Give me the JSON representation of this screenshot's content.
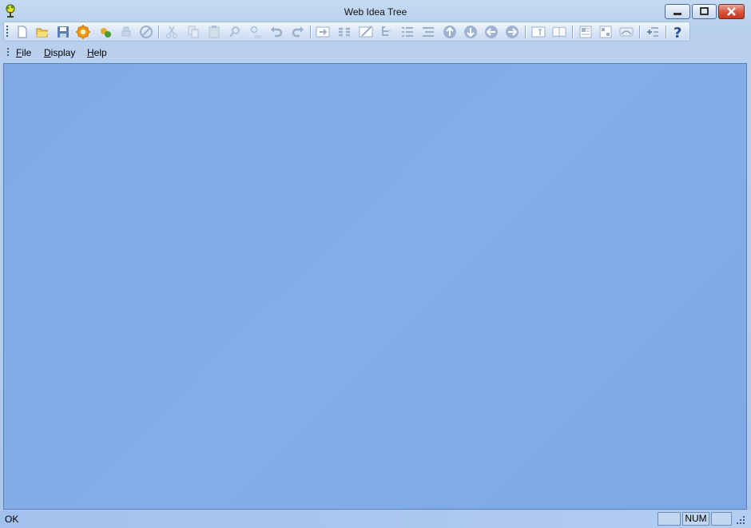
{
  "window": {
    "title": "Web Idea Tree",
    "icon": "tree-icon",
    "controls": [
      "minimize-icon",
      "maximize-icon",
      "close-icon"
    ]
  },
  "toolbar": {
    "buttons": [
      {
        "name": "new-file",
        "icon": "new-file-icon",
        "enabled": true
      },
      {
        "name": "open-folder",
        "icon": "open-folder-icon",
        "enabled": true
      },
      {
        "name": "save",
        "icon": "save-icon",
        "enabled": true
      },
      {
        "name": "publish",
        "icon": "publish-gear-icon",
        "enabled": true
      },
      {
        "name": "web-export",
        "icon": "web-export-icon",
        "enabled": true
      },
      {
        "name": "print",
        "icon": "print-icon",
        "enabled": false
      },
      {
        "name": "cancel",
        "icon": "cancel-icon",
        "enabled": false
      },
      {
        "name": "cut",
        "icon": "cut-icon",
        "enabled": false
      },
      {
        "name": "copy",
        "icon": "copy-icon",
        "enabled": false
      },
      {
        "name": "paste",
        "icon": "paste-icon",
        "enabled": false
      },
      {
        "name": "find",
        "icon": "find-icon",
        "enabled": false
      },
      {
        "name": "replace",
        "icon": "replace-icon",
        "enabled": false
      },
      {
        "name": "undo",
        "icon": "undo-icon",
        "enabled": false
      },
      {
        "name": "redo",
        "icon": "redo-icon",
        "enabled": false
      },
      {
        "name": "insert-node",
        "icon": "insert-node-icon",
        "enabled": false
      },
      {
        "name": "insert-sibling",
        "icon": "insert-sibling-icon",
        "enabled": false
      },
      {
        "name": "edit-node",
        "icon": "edit-node-icon",
        "enabled": false
      },
      {
        "name": "tree-view",
        "icon": "tree-view-icon",
        "enabled": false
      },
      {
        "name": "list-view",
        "icon": "list-view-icon",
        "enabled": false
      },
      {
        "name": "outline-view",
        "icon": "outline-view-icon",
        "enabled": false
      },
      {
        "name": "move-up",
        "icon": "arrow-up-icon",
        "enabled": false
      },
      {
        "name": "move-down",
        "icon": "arrow-down-icon",
        "enabled": false
      },
      {
        "name": "move-left",
        "icon": "arrow-left-icon",
        "enabled": false
      },
      {
        "name": "move-right",
        "icon": "arrow-right-icon",
        "enabled": false
      },
      {
        "name": "text-frame",
        "icon": "text-frame-icon",
        "enabled": false
      },
      {
        "name": "book",
        "icon": "book-icon",
        "enabled": false
      },
      {
        "name": "layout-1",
        "icon": "layout-icon",
        "enabled": false
      },
      {
        "name": "layout-2",
        "icon": "grid-layout-icon",
        "enabled": false
      },
      {
        "name": "link",
        "icon": "link-icon",
        "enabled": false
      },
      {
        "name": "add-item",
        "icon": "add-item-icon",
        "enabled": false
      },
      {
        "name": "help",
        "icon": "help-icon",
        "enabled": true
      }
    ]
  },
  "menu": {
    "items": [
      {
        "label_access": "F",
        "label_rest": "ile"
      },
      {
        "label_access": "D",
        "label_rest": "isplay"
      },
      {
        "label_access": "H",
        "label_rest": "elp"
      }
    ]
  },
  "status": {
    "text": "OK",
    "pane_num": "NUM",
    "pane_1": "",
    "pane_3": ""
  },
  "colors": {
    "workspace": "#82abe8",
    "chrome": "#b9d1ee",
    "disabled_icon": "#aebfd6",
    "help_icon": "#2b4f8a"
  }
}
